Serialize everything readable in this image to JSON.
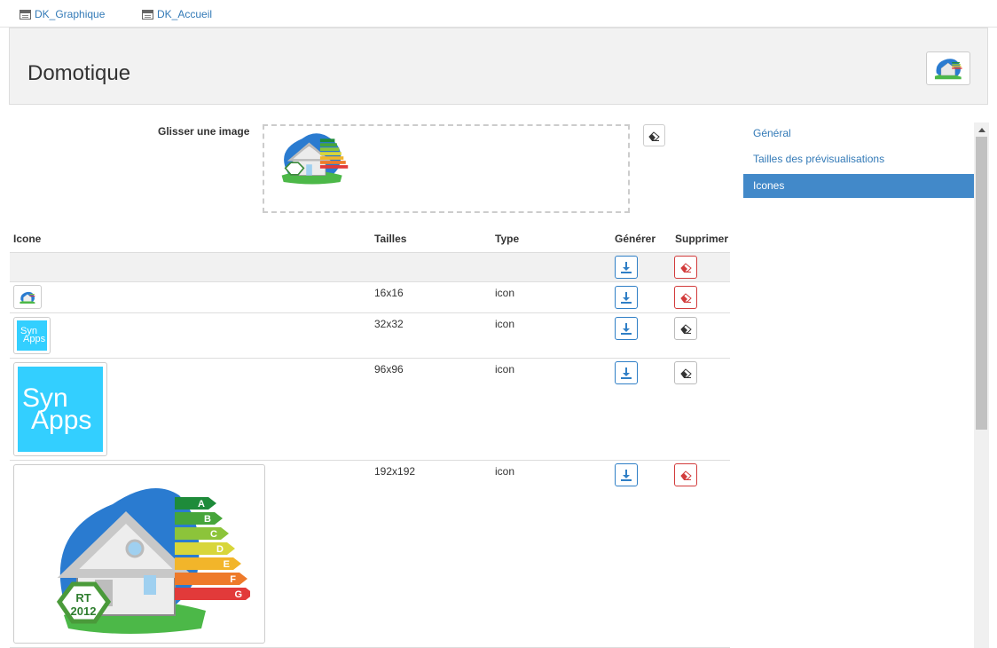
{
  "topbar": {
    "links": [
      {
        "label": "DK_Graphique"
      },
      {
        "label": "DK_Accueil"
      }
    ]
  },
  "header": {
    "title": "Domotique"
  },
  "upload": {
    "label": "Glisser une image"
  },
  "table": {
    "headers": {
      "icon": "Icone",
      "sizes": "Tailles",
      "type": "Type",
      "generate": "Générer",
      "delete": "Supprimer"
    },
    "rows": [
      {
        "size": "16x16",
        "type": "icon",
        "delete_state": "active"
      },
      {
        "size": "32x32",
        "type": "icon",
        "delete_state": "disabled"
      },
      {
        "size": "96x96",
        "type": "icon",
        "delete_state": "disabled"
      },
      {
        "size": "192x192",
        "type": "icon",
        "delete_state": "active"
      }
    ]
  },
  "sidebar": {
    "items": [
      {
        "label": "Général",
        "active": false
      },
      {
        "label": "Tailles des prévisualisations",
        "active": false
      },
      {
        "label": "Icones",
        "active": true
      }
    ]
  },
  "thumbs": {
    "synapps_line1": "Syn",
    "synapps_line2": "Apps",
    "rt_label": "RT",
    "rt_year": "2012",
    "energy_letters": [
      "A",
      "B",
      "C",
      "D",
      "E",
      "F",
      "G"
    ]
  },
  "colors": {
    "accent": "#4289c9",
    "link": "#337ab7",
    "danger": "#d23c3c",
    "synapps_bg": "#33cfff",
    "energy": [
      "#1e8b3a",
      "#46a53a",
      "#8cc43a",
      "#d8d63a",
      "#f2b52a",
      "#ee7a2a",
      "#e23a3a"
    ]
  },
  "icons": [
    "document-icon",
    "download-icon",
    "eraser-icon",
    "chevron-up-icon"
  ]
}
